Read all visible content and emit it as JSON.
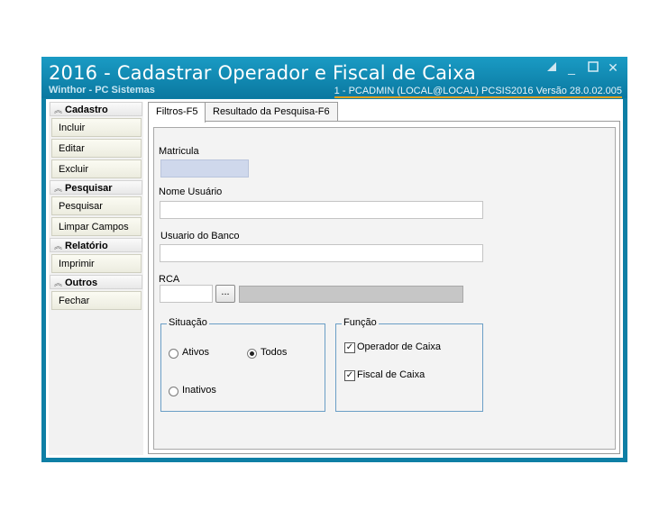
{
  "window": {
    "title": "2016 - Cadastrar Operador e Fiscal de Caixa",
    "subtitle": "Winthor - PC Sistemas",
    "status": "1 - PCADMIN (LOCAL@LOCAL)   PCSIS2016  Versão  28.0.02.005",
    "colors": {
      "titlebar": "#0e7fa5",
      "accent": "#e0a020"
    }
  },
  "sidebar": {
    "groups": [
      {
        "label": "Cadastro",
        "items": [
          "Incluir",
          "Editar",
          "Excluir"
        ]
      },
      {
        "label": "Pesquisar",
        "items": [
          "Pesquisar",
          "Limpar Campos"
        ]
      },
      {
        "label": "Relatório",
        "items": [
          "Imprimir"
        ]
      },
      {
        "label": "Outros",
        "items": [
          "Fechar"
        ]
      }
    ]
  },
  "tabs": [
    {
      "label": "Filtros-F5",
      "active": true
    },
    {
      "label": "Resultado da Pesquisa-F6",
      "active": false
    }
  ],
  "form": {
    "matricula_label": "Matricula",
    "matricula_value": "",
    "nome_label": "Nome Usuário",
    "nome_value": "",
    "banco_label": "Usuario do Banco",
    "banco_value": "",
    "rca_label": "RCA",
    "rca_value": "",
    "rca_button": "...",
    "rca_desc": "",
    "situacao": {
      "title": "Situação",
      "options": [
        "Ativos",
        "Todos",
        "Inativos"
      ],
      "selected": "Todos"
    },
    "funcao": {
      "title": "Função",
      "options": [
        {
          "label": "Operador de Caixa",
          "checked": true
        },
        {
          "label": "Fiscal de Caixa",
          "checked": true
        }
      ]
    }
  }
}
